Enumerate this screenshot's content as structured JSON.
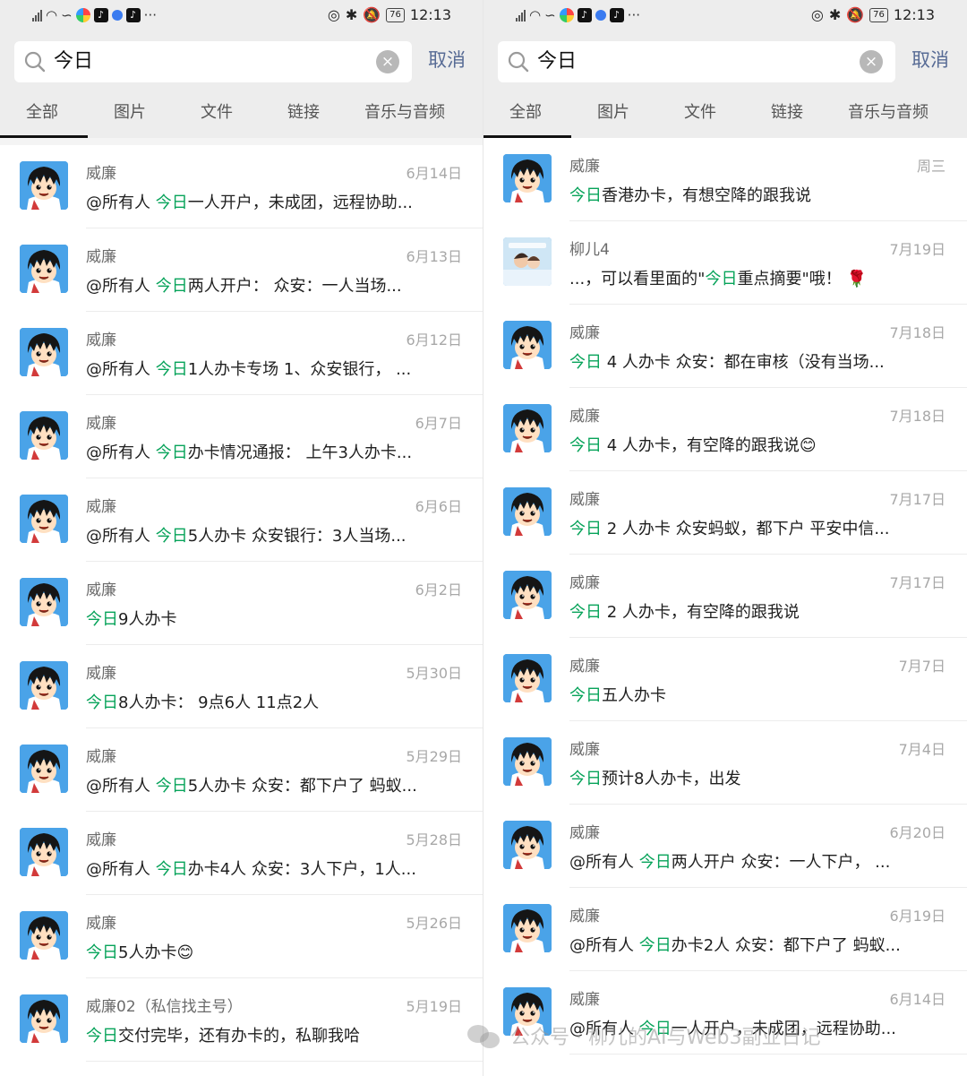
{
  "status": {
    "left": {
      "time": "12:13",
      "battery": "76"
    },
    "right": {
      "time": "12:13",
      "battery": "76"
    }
  },
  "search": {
    "query": "今日",
    "cancel_label": "取消"
  },
  "tabs": [
    "全部",
    "图片",
    "文件",
    "链接",
    "音乐与音频"
  ],
  "left_results": [
    {
      "name": "威廉",
      "date": "6月14日",
      "pre": "@所有人 ",
      "hl": "今日",
      "post": "一人开户，未成团，远程协助..."
    },
    {
      "name": "威廉",
      "date": "6月13日",
      "pre": "@所有人 ",
      "hl": "今日",
      "post": "两人开户： 众安：一人当场..."
    },
    {
      "name": "威廉",
      "date": "6月12日",
      "pre": "@所有人 ",
      "hl": "今日",
      "post": "1人办卡专场 1、众安银行， ..."
    },
    {
      "name": "威廉",
      "date": "6月7日",
      "pre": "@所有人 ",
      "hl": "今日",
      "post": "办卡情况通报： 上午3人办卡..."
    },
    {
      "name": "威廉",
      "date": "6月6日",
      "pre": "@所有人 ",
      "hl": "今日",
      "post": "5人办卡 众安银行：3人当场..."
    },
    {
      "name": "威廉",
      "date": "6月2日",
      "pre": "",
      "hl": "今日",
      "post": "9人办卡"
    },
    {
      "name": "威廉",
      "date": "5月30日",
      "pre": "",
      "hl": "今日",
      "post": "8人办卡： 9点6人 11点2人"
    },
    {
      "name": "威廉",
      "date": "5月29日",
      "pre": "@所有人 ",
      "hl": "今日",
      "post": "5人办卡 众安：都下户了 蚂蚁..."
    },
    {
      "name": "威廉",
      "date": "5月28日",
      "pre": "@所有人 ",
      "hl": "今日",
      "post": "办卡4人 众安：3人下户，1人..."
    },
    {
      "name": "威廉",
      "date": "5月26日",
      "pre": "",
      "hl": "今日",
      "post": "5人办卡😊"
    },
    {
      "name": "威廉02（私信找主号）",
      "date": "5月19日",
      "pre": "",
      "hl": "今日",
      "post": "交付完毕，还有办卡的，私聊我哈"
    }
  ],
  "right_results": [
    {
      "name": "威廉",
      "date": "周三",
      "pre": "",
      "hl": "今日",
      "post": "香港办卡，有想空降的跟我说",
      "avatar": "boy"
    },
    {
      "name": "柳儿4",
      "date": "7月19日",
      "pre": "...，可以看里面的\"",
      "hl": "今日",
      "post": "重点摘要\"哦！ 🌹",
      "avatar": "photo"
    },
    {
      "name": "威廉",
      "date": "7月18日",
      "pre": "",
      "hl": "今日",
      "post": " 4 人办卡 众安：都在审核（没有当场...",
      "avatar": "boy"
    },
    {
      "name": "威廉",
      "date": "7月18日",
      "pre": "",
      "hl": "今日",
      "post": " 4 人办卡，有空降的跟我说😊",
      "avatar": "boy"
    },
    {
      "name": "威廉",
      "date": "7月17日",
      "pre": "",
      "hl": "今日",
      "post": " 2 人办卡 众安蚂蚁，都下户 平安中信...",
      "avatar": "boy"
    },
    {
      "name": "威廉",
      "date": "7月17日",
      "pre": "",
      "hl": "今日",
      "post": " 2 人办卡，有空降的跟我说",
      "avatar": "boy"
    },
    {
      "name": "威廉",
      "date": "7月7日",
      "pre": "",
      "hl": "今日",
      "post": "五人办卡",
      "avatar": "boy"
    },
    {
      "name": "威廉",
      "date": "7月4日",
      "pre": "",
      "hl": "今日",
      "post": "预计8人办卡，出发",
      "avatar": "boy"
    },
    {
      "name": "威廉",
      "date": "6月20日",
      "pre": "@所有人 ",
      "hl": "今日",
      "post": "两人开户 众安：一人下户， ...",
      "avatar": "boy"
    },
    {
      "name": "威廉",
      "date": "6月19日",
      "pre": "@所有人 ",
      "hl": "今日",
      "post": "办卡2人 众安：都下户了 蚂蚁...",
      "avatar": "boy"
    },
    {
      "name": "威廉",
      "date": "6月14日",
      "pre": "@所有人 ",
      "hl": "今日",
      "post": "一人开户，未成团，远程协助...",
      "avatar": "boy"
    }
  ],
  "watermark": "公众号 · 柳儿的AI与Web3副业日记",
  "colors": {
    "highlight": "#07a35a",
    "cancel": "#576b95",
    "header_bg": "#ededed"
  }
}
